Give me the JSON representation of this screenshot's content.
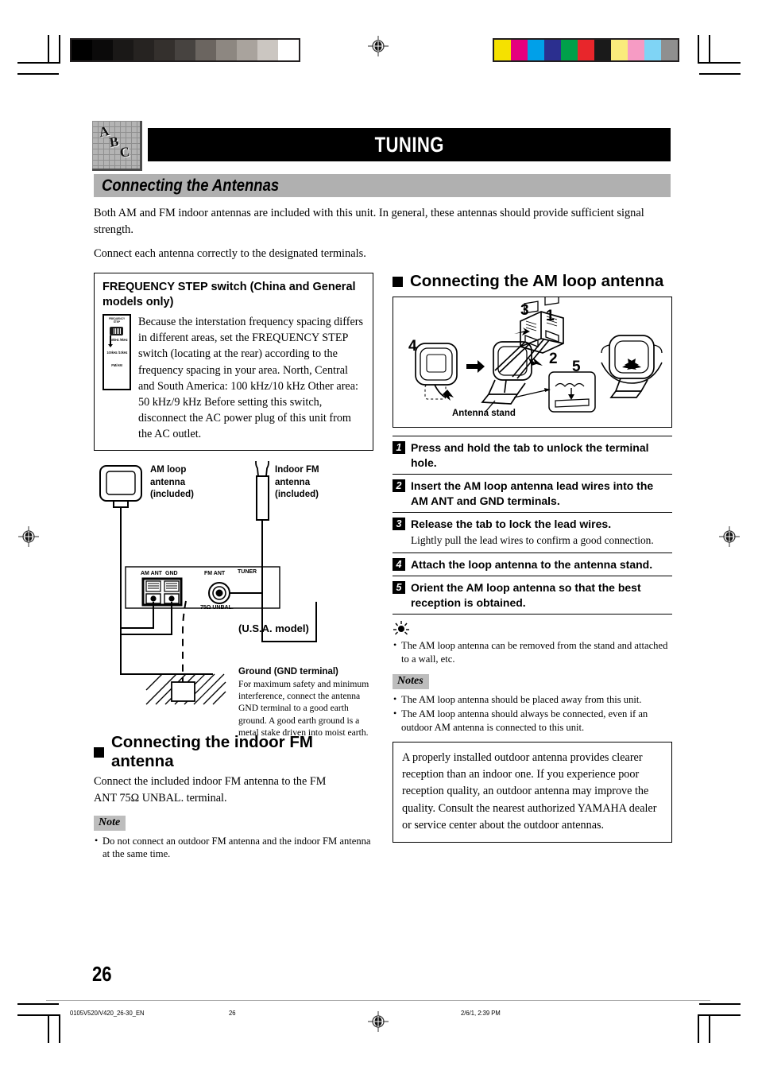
{
  "chapter_icon": {
    "letters": [
      "A",
      "B",
      "C"
    ],
    "name": "abc-graph-icon"
  },
  "header": {
    "title": "TUNING"
  },
  "section": {
    "title": "Connecting the Antennas"
  },
  "intro": {
    "paragraph_1": "Both AM and FM indoor antennas are included with this unit. In general, these antennas should provide sufficient signal strength.",
    "paragraph_2": "Connect each antenna correctly to the designated terminals."
  },
  "frequency_step_box": {
    "heading": "FREQUENCY STEP switch (China and General models only)",
    "switch_graphic": {
      "top_label": "FREQUENCY STEP",
      "option_1": "50kHz /9kHz",
      "option_2": "100kHz /10kHz",
      "bottom_label": "FM/AM"
    },
    "body": "Because the interstation frequency spacing differs in different areas, set the FREQUENCY STEP switch (locating at the rear) according to the frequency spacing in your area. North, Central and South America: 100 kHz/10 kHz Other area: 50 kHz/9 kHz Before setting this switch, disconnect the AC power plug of this unit from the AC outlet."
  },
  "wiring_diagram": {
    "am_loop_label": "AM loop antenna (included)",
    "indoor_fm_label": "Indoor FM antenna (included)",
    "terminal_panel": {
      "tuner": "TUNER",
      "am_ant": "AM ANT",
      "gnd": "GND",
      "fm_ant": "FM ANT",
      "impedance": "75Ω UNBAL."
    },
    "model_note": "(U.S.A. model)",
    "ground_title": "Ground (GND terminal)",
    "ground_body": "For maximum safety and minimum interference, connect the antenna GND terminal to a good earth ground. A good earth ground is a metal stake driven into moist earth."
  },
  "fm_section": {
    "heading": "Connecting the indoor FM antenna",
    "body": "Connect the included indoor FM antenna to the FM ANT 75Ω UNBAL. terminal.",
    "note_label": "Note",
    "notes": [
      "Do not connect an outdoor FM antenna and the indoor FM antenna at the same time."
    ]
  },
  "am_section": {
    "heading": "Connecting the AM loop antenna",
    "figure": {
      "callouts": [
        "1",
        "2",
        "3",
        "4",
        "5"
      ],
      "stand_label": "Antenna stand"
    },
    "steps": [
      {
        "n": "1",
        "title": "Press and hold the tab to unlock the terminal hole.",
        "detail": ""
      },
      {
        "n": "2",
        "title": "Insert the AM loop antenna lead wires into the AM ANT and GND terminals.",
        "detail": ""
      },
      {
        "n": "3",
        "title": "Release the tab to lock the lead wires.",
        "detail": "Lightly pull the lead wires to confirm a good connection."
      },
      {
        "n": "4",
        "title": "Attach the loop antenna to the antenna stand.",
        "detail": ""
      },
      {
        "n": "5",
        "title": "Orient the AM loop antenna so that the best reception is obtained.",
        "detail": ""
      }
    ],
    "tips": [
      "The AM loop antenna can be removed from the stand and attached to a wall, etc."
    ],
    "notes_label": "Notes",
    "notes": [
      "The AM loop antenna should be placed away from this unit.",
      "The AM loop antenna should always be connected, even if an outdoor AM antenna is connected to this unit."
    ],
    "outdoor_box": "A properly installed outdoor antenna provides clearer reception than an indoor one. If you experience poor reception quality, an outdoor antenna may improve the quality. Consult the nearest authorized YAMAHA dealer or service center about the outdoor antennas."
  },
  "page": {
    "number": "26"
  },
  "footer": {
    "file": "0105V520/V420_26-30_EN",
    "page": "26",
    "timestamp": "2/6/1, 2:39 PM"
  },
  "calibration": {
    "grayscale": [
      "#000000",
      "#0b0a0a",
      "#1a1817",
      "#262321",
      "#34302d",
      "#474340",
      "#6b6560",
      "#8d8781",
      "#a9a39d",
      "#cbc6c1",
      "#ffffff"
    ],
    "colors": [
      "#f5e100",
      "#e5007e",
      "#00a0e9",
      "#2b2f8f",
      "#00a04a",
      "#e8262b",
      "#1a1a1a",
      "#faeb7c",
      "#f69bc4",
      "#7fd4f5",
      "#8f8f8f"
    ]
  }
}
